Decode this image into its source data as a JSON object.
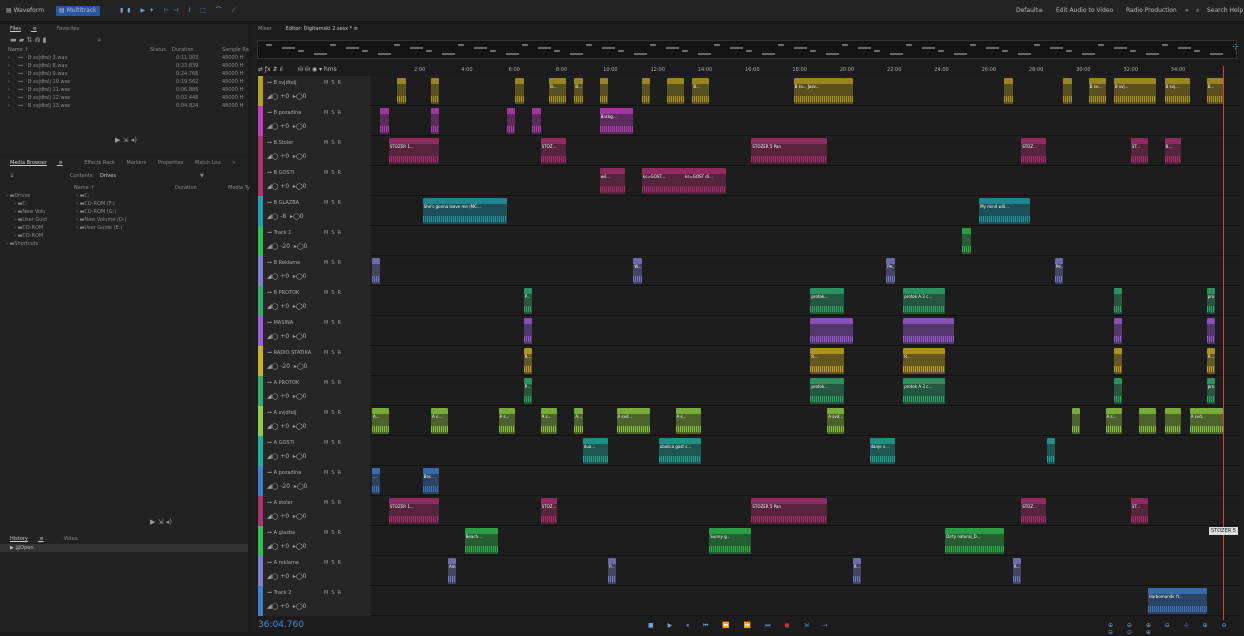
{
  "topbar": {
    "waveform": "Waveform",
    "multitrack": "Multitrack",
    "default_ws": "Default",
    "ws_menu": "≡",
    "edit_audio_to_video": "Edit Audio to Video",
    "radio_production": "Radio Production",
    "more": "»",
    "search": "Search Help"
  },
  "files_panel": {
    "tab_files": "Files",
    "tab_files_menu": "≡",
    "tab_favorites": "Favorites",
    "col_name": "Name ↑",
    "col_status": "Status",
    "col_duration": "Duration",
    "col_sample": "Sample Ra",
    "files": [
      {
        "name": "B svjdtelj 3.wav",
        "duration": "0:11.003",
        "sample": "48000 H"
      },
      {
        "name": "B svjdtelj 8.wav",
        "duration": "0:23.839",
        "sample": "48000 H"
      },
      {
        "name": "B svjdtelj 9.wav",
        "duration": "0:24.768",
        "sample": "48000 H"
      },
      {
        "name": "B svjdtelj 10.wav",
        "duration": "0:19.562",
        "sample": "48000 H"
      },
      {
        "name": "B svjdtelj 11.wav",
        "duration": "0:06.885",
        "sample": "48000 H"
      },
      {
        "name": "B svjdtelj 12.wav",
        "duration": "0:02.448",
        "sample": "48000 H"
      },
      {
        "name": "B svjdtelj 13.wav",
        "duration": "0:04.824",
        "sample": "48000 H"
      }
    ]
  },
  "media_browser": {
    "tab": "Media Browser",
    "tab_menu": "≡",
    "effects_rack": "Effects Rack",
    "markers": "Markers",
    "properties": "Properties",
    "match_loudness": "Match Lou",
    "more": "»",
    "contents_label": "Contents:",
    "contents_value": "Drives",
    "col_name": "Name ↑",
    "col_duration": "Duration",
    "col_media": "Media Ty",
    "tree": [
      "Drives",
      "C:",
      "New Volu",
      "User Guid",
      "CD-ROM",
      "CD-ROM",
      "Shortcuts"
    ],
    "list": [
      "C:",
      "CD-ROM (F:)",
      "CD-ROM (G:)",
      "New Volume (D:)",
      "User Guide (E:)"
    ]
  },
  "history": {
    "tab": "History",
    "tab_menu": "≡",
    "video": "Video",
    "item": "Open"
  },
  "editor": {
    "mixer": "Mixer",
    "tab": "Editor: Digitarnski 2.sesx *",
    "tab_menu": "≡",
    "hms": "hms",
    "timecode": "36:04.760",
    "tooltip": "STOZER 5",
    "ruler": [
      "2:00",
      "4:00",
      "6:00",
      "8:00",
      "10:00",
      "12:00",
      "14:00",
      "16:00",
      "18:00",
      "20:00",
      "22:00",
      "24:00",
      "26:00",
      "28:00",
      "30:00",
      "32:00",
      "34:00"
    ],
    "tracks": [
      {
        "name": "B svjdtelj",
        "vol": "+0",
        "color": "#b8a020",
        "clips": [
          [
            3,
            1,
            ""
          ],
          [
            7,
            1,
            ""
          ],
          [
            17,
            1,
            ""
          ],
          [
            21,
            2,
            "B..."
          ],
          [
            24,
            1,
            "B..."
          ],
          [
            27,
            1,
            ""
          ],
          [
            32,
            1,
            ""
          ],
          [
            35,
            2,
            ""
          ],
          [
            38,
            2,
            "B..."
          ],
          [
            50,
            6,
            "B sv...  Jasv..."
          ],
          [
            56,
            1,
            ""
          ],
          [
            75,
            1,
            ""
          ],
          [
            82,
            1,
            ""
          ],
          [
            85,
            2,
            "B sv..."
          ],
          [
            88,
            5,
            "B svj..."
          ],
          [
            94,
            3,
            "B svj..."
          ],
          [
            99,
            2,
            "B..."
          ]
        ]
      },
      {
        "name": "B pozadina",
        "vol": "+0",
        "color": "#c040c0",
        "clips": [
          [
            1,
            1,
            ""
          ],
          [
            7,
            1,
            ""
          ],
          [
            16,
            1,
            ""
          ],
          [
            19,
            1,
            ""
          ],
          [
            27,
            4,
            "Backg..."
          ]
        ]
      },
      {
        "name": "B.Stoler",
        "vol": "+0",
        "color": "#b03070",
        "clips": [
          [
            2,
            6,
            "STOZER 1..."
          ],
          [
            20,
            3,
            "STOZ..."
          ],
          [
            45,
            9,
            "STOZER 5   Pan"
          ],
          [
            77,
            3,
            "STOZ..."
          ],
          [
            90,
            2,
            "ST..."
          ],
          [
            94,
            2,
            "B..."
          ]
        ]
      },
      {
        "name": "B GOSTI",
        "vol": "+0",
        "color": "#b03070",
        "clips": [
          [
            27,
            3,
            "wil..."
          ],
          [
            32,
            5,
            "ks=GOST..."
          ],
          [
            37,
            5,
            "ks=GOST di..."
          ]
        ]
      },
      {
        "name": "B GLAZBA",
        "vol": "-8",
        "color": "#20a0b0",
        "clips": [
          [
            6,
            10,
            "She's gonna leave me (MC..."
          ],
          [
            72,
            6,
            "My mind will..."
          ]
        ]
      },
      {
        "name": "Track 1",
        "vol": "-20",
        "color": "#30c050",
        "clips": [
          [
            70,
            1,
            ""
          ]
        ]
      },
      {
        "name": "B Reklame",
        "vol": "+0",
        "color": "#8080d0",
        "clips": [
          [
            0,
            1,
            ""
          ],
          [
            31,
            1,
            "W..."
          ],
          [
            61,
            1,
            "Pe..."
          ],
          [
            81,
            1,
            "Pe..."
          ]
        ]
      },
      {
        "name": "B PROTOK",
        "vol": "+0",
        "color": "#30b070",
        "clips": [
          [
            18,
            1,
            "P..."
          ],
          [
            52,
            4,
            "protok..."
          ],
          [
            63,
            5,
            "protok A 2 c..."
          ],
          [
            88,
            1,
            ""
          ],
          [
            99,
            1,
            "pro..."
          ]
        ]
      },
      {
        "name": "MASINA",
        "vol": "+0",
        "color": "#a060e0",
        "clips": [
          [
            18,
            1,
            ""
          ],
          [
            52,
            5,
            ""
          ],
          [
            63,
            6,
            ""
          ],
          [
            88,
            1,
            ""
          ],
          [
            99,
            1,
            ""
          ]
        ]
      },
      {
        "name": "RADIO STATIKA",
        "vol": "-20",
        "color": "#d0b020",
        "clips": [
          [
            18,
            1,
            "R..."
          ],
          [
            52,
            4,
            "R..."
          ],
          [
            63,
            5,
            "R..."
          ],
          [
            88,
            1,
            ""
          ],
          [
            99,
            1,
            "R..."
          ]
        ]
      },
      {
        "name": "A PROTOK",
        "vol": "+0",
        "color": "#30b070",
        "clips": [
          [
            18,
            1,
            "P..."
          ],
          [
            52,
            4,
            "protok..."
          ],
          [
            63,
            5,
            "protok A 3 c..."
          ],
          [
            88,
            1,
            ""
          ],
          [
            99,
            1,
            "pro..."
          ]
        ]
      },
      {
        "name": "A svjdtelj",
        "vol": "+0",
        "color": "#90d040",
        "clips": [
          [
            0,
            2,
            "A..."
          ],
          [
            7,
            2,
            "A s..."
          ],
          [
            15,
            2,
            "A s..."
          ],
          [
            20,
            2,
            "A s..."
          ],
          [
            24,
            1,
            "A..."
          ],
          [
            29,
            4,
            "A svd..."
          ],
          [
            36,
            3,
            "A s..."
          ],
          [
            54,
            2,
            "A svd..."
          ],
          [
            83,
            1,
            ""
          ],
          [
            87,
            2,
            "A s..."
          ],
          [
            91,
            2,
            ""
          ],
          [
            94,
            2,
            ""
          ],
          [
            97,
            4,
            "A svd..."
          ]
        ]
      },
      {
        "name": "A GOSTI",
        "vol": "+0",
        "color": "#20b0a0",
        "clips": [
          [
            25,
            3,
            "dua..."
          ],
          [
            34,
            5,
            "ubollca gost s..."
          ],
          [
            59,
            3,
            "danje s..."
          ],
          [
            80,
            1,
            ""
          ]
        ]
      },
      {
        "name": "A pozadina",
        "vol": "-20",
        "color": "#4080d0",
        "clips": [
          [
            0,
            1,
            "..."
          ],
          [
            6,
            2,
            "Bac..."
          ]
        ]
      },
      {
        "name": "A stoler",
        "vol": "+0",
        "color": "#b03070",
        "clips": [
          [
            2,
            6,
            "STOZER 1..."
          ],
          [
            20,
            2,
            "STOZ..."
          ],
          [
            45,
            9,
            "STOZER 5   Pan"
          ],
          [
            77,
            3,
            "STOZ..."
          ],
          [
            90,
            2,
            "ST..."
          ]
        ]
      },
      {
        "name": "A glazba",
        "vol": "+0",
        "color": "#30c050",
        "clips": [
          [
            11,
            4,
            "Beach..."
          ],
          [
            40,
            5,
            "Sunny g..."
          ],
          [
            68,
            7,
            "Dirty natural_D..."
          ]
        ]
      },
      {
        "name": "A reklame",
        "vol": "+0",
        "color": "#8080d0",
        "clips": [
          [
            9,
            1,
            "Am..."
          ],
          [
            28,
            1,
            "P..."
          ],
          [
            57,
            1,
            "R..."
          ],
          [
            76,
            1,
            "R..."
          ]
        ]
      },
      {
        "name": "Track 2",
        "vol": "+0",
        "color": "#4080d0",
        "clips": [
          [
            92,
            7,
            "Harbomandir ft..."
          ]
        ]
      }
    ]
  },
  "transport_icons": [
    "stop-icon",
    "play-icon",
    "pause-icon",
    "skip-start-icon",
    "rewind-icon",
    "forward-icon",
    "skip-end-icon",
    "record-icon",
    "loop-icon",
    "skip-icon"
  ]
}
